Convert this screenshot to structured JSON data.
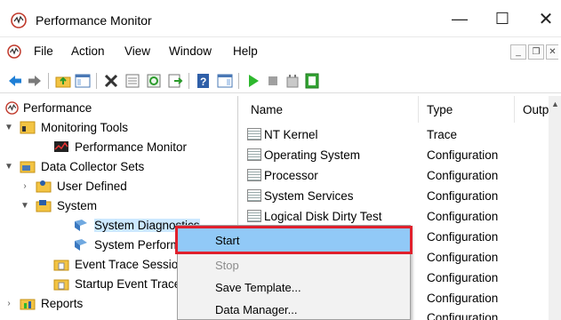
{
  "window": {
    "title": "Performance Monitor",
    "controls": {
      "minimize": "—",
      "maximize": "☐",
      "close": "✕"
    }
  },
  "menubar": {
    "items": [
      "File",
      "Action",
      "View",
      "Window",
      "Help"
    ]
  },
  "tree": {
    "root": "Performance",
    "nodes": [
      {
        "label": "Monitoring Tools"
      },
      {
        "label": "Performance Monitor"
      },
      {
        "label": "Data Collector Sets"
      },
      {
        "label": "User Defined"
      },
      {
        "label": "System"
      },
      {
        "label": "System Diagnostics"
      },
      {
        "label": "System Performance"
      },
      {
        "label": "Event Trace Sessions"
      },
      {
        "label": "Startup Event Trace Sessions"
      },
      {
        "label": "Reports"
      }
    ]
  },
  "list": {
    "columns": [
      "Name",
      "Type",
      "Outp"
    ],
    "rows": [
      {
        "name": "NT Kernel",
        "type": "Trace"
      },
      {
        "name": "Operating System",
        "type": "Configuration"
      },
      {
        "name": "Processor",
        "type": "Configuration"
      },
      {
        "name": "System Services",
        "type": "Configuration"
      },
      {
        "name": "Logical Disk Dirty Test",
        "type": "Configuration"
      },
      {
        "name": "",
        "type": "Configuration"
      },
      {
        "name": "",
        "type": "Configuration"
      },
      {
        "name": "",
        "type": "Configuration"
      },
      {
        "name": "",
        "type": "Configuration"
      },
      {
        "name": "",
        "type": "Configuration"
      }
    ]
  },
  "context_menu": {
    "items": [
      {
        "label": "Start",
        "state": "highlighted"
      },
      {
        "label": "Stop",
        "state": "disabled"
      },
      {
        "label": "Save Template..."
      },
      {
        "label": "Data Manager..."
      }
    ]
  },
  "colors": {
    "highlight": "#91c9f7",
    "callout_border": "#e0202c",
    "start_green": "#2eb82e"
  }
}
